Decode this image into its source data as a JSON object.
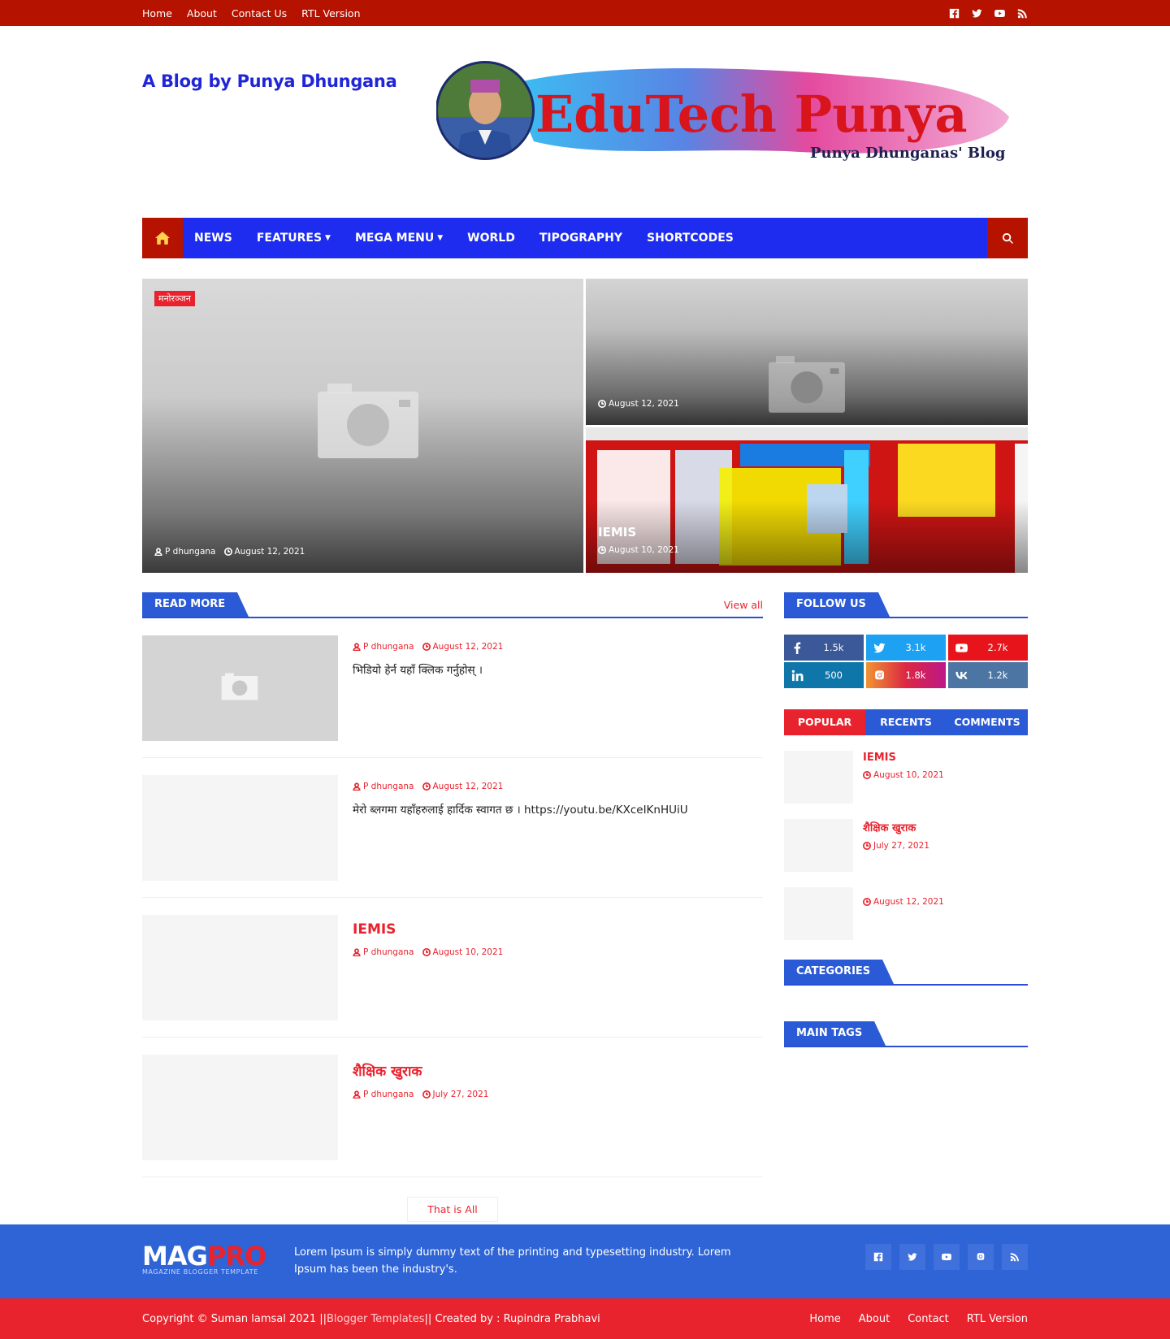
{
  "topbar": {
    "links": [
      "Home",
      "About",
      "Contact Us",
      "RTL Version"
    ],
    "social_icons": [
      "facebook-icon",
      "twitter-icon",
      "youtube-icon",
      "rss-icon"
    ]
  },
  "header": {
    "blog_title": "A Blog by Punya Dhungana",
    "banner_title": "EduTech Punya",
    "banner_subtitle": "Punya Dhunganas' Blog"
  },
  "nav": {
    "items": [
      {
        "label": "NEWS",
        "dropdown": false
      },
      {
        "label": "FEATURES",
        "dropdown": true
      },
      {
        "label": "MEGA MENU",
        "dropdown": true
      },
      {
        "label": "WORLD",
        "dropdown": false
      },
      {
        "label": "TIPOGRAPHY",
        "dropdown": false
      },
      {
        "label": "SHORTCODES",
        "dropdown": false
      }
    ]
  },
  "hero": {
    "main": {
      "badge": "मनोरञ्जन",
      "author": "P dhungana",
      "date": "August 12, 2021"
    },
    "right_top": {
      "date": "August 12, 2021"
    },
    "right_bottom": {
      "title": "IEMIS",
      "date": "August 10, 2021"
    }
  },
  "read_more": {
    "heading": "READ MORE",
    "view_all": "View all",
    "posts": [
      {
        "title": "",
        "author": "P dhungana",
        "date": "August 12, 2021",
        "excerpt": "भिडियो हेर्न यहाँ क्लिक गर्नुहोस् ।"
      },
      {
        "title": "",
        "author": "P dhungana",
        "date": "August 12, 2021",
        "excerpt": "मेरो ब्लगमा यहाँहरुलाई हार्दिक स्वागत छ । https://youtu.be/KXceIKnHUiU"
      },
      {
        "title": "IEMIS",
        "author": "P dhungana",
        "date": "August 10, 2021",
        "excerpt": ""
      },
      {
        "title": "शैक्षिक खुराक",
        "author": "P dhungana",
        "date": "July 27, 2021",
        "excerpt": ""
      }
    ],
    "end_label": "That is All"
  },
  "sidebar": {
    "follow_heading": "FOLLOW US",
    "social_counts": [
      {
        "icon": "facebook-icon",
        "count": "1.5k"
      },
      {
        "icon": "twitter-icon",
        "count": "3.1k"
      },
      {
        "icon": "youtube-icon",
        "count": "2.7k"
      },
      {
        "icon": "linkedin-icon",
        "count": "500"
      },
      {
        "icon": "instagram-icon",
        "count": "1.8k"
      },
      {
        "icon": "vk-icon",
        "count": "1.2k"
      }
    ],
    "tabs": [
      "POPULAR",
      "RECENTS",
      "COMMENTS"
    ],
    "popular": [
      {
        "title": "IEMIS",
        "date": "August 10, 2021"
      },
      {
        "title": "शैक्षिक खुराक",
        "date": "July 27, 2021"
      },
      {
        "title": "",
        "date": "August 12, 2021"
      }
    ],
    "categories_heading": "CATEGORIES",
    "tags_heading": "MAIN TAGS"
  },
  "footer": {
    "logo_a": "MAG",
    "logo_b": "PRO",
    "logo_sub": "MAGAZINE BLOGGER TEMPLATE",
    "about": "Lorem Ipsum is simply dummy text of the printing and typesetting industry. Lorem Ipsum has been the industry's.",
    "social_icons": [
      "facebook-icon",
      "twitter-icon",
      "youtube-icon",
      "instagram-icon",
      "rss-icon"
    ]
  },
  "bottombar": {
    "copy_a": "Copyright © Suman lamsal 2021 ||",
    "copy_link": "Blogger Templates",
    "copy_b": "|| Created by : Rupindra Prabhavi",
    "links": [
      "Home",
      "About",
      "Contact",
      "RTL Version"
    ]
  },
  "colors": {
    "topbar": "#b51200",
    "nav": "#1e2cf0",
    "accent": "#e8232e",
    "section": "#2b5ad6",
    "footer": "#2e64d6"
  }
}
